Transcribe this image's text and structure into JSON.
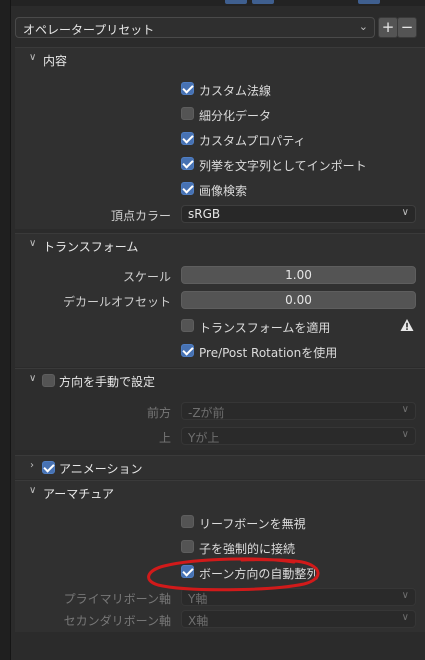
{
  "preset": {
    "label": "オペレータープリセット",
    "add": "+",
    "remove": "−"
  },
  "content": {
    "title": "内容",
    "items": [
      {
        "label": "カスタム法線",
        "checked": true
      },
      {
        "label": "細分化データ",
        "checked": false
      },
      {
        "label": "カスタムプロパティ",
        "checked": true
      },
      {
        "label": "列挙を文字列としてインポート",
        "checked": true
      },
      {
        "label": "画像検索",
        "checked": true
      }
    ],
    "vertex_color": {
      "label": "頂点カラー",
      "value": "sRGB"
    }
  },
  "transform": {
    "title": "トランスフォーム",
    "scale": {
      "label": "スケール",
      "value": "1.00"
    },
    "decal_offset": {
      "label": "デカールオフセット",
      "value": "0.00"
    },
    "apply_transform": {
      "label": "トランスフォームを適用",
      "checked": false
    },
    "pre_post_rotation": {
      "label": "Pre/Post Rotationを使用",
      "checked": true
    }
  },
  "manual_orientation": {
    "title": "方向を手動で設定",
    "checked": false,
    "forward": {
      "label": "前方",
      "value": "-Zが前"
    },
    "up": {
      "label": "上",
      "value": "Yが上"
    }
  },
  "animation": {
    "title": "アニメーション",
    "checked": true
  },
  "armature": {
    "title": "アーマチュア",
    "ignore_leaf_bones": {
      "label": "リーフボーンを無視",
      "checked": false
    },
    "force_connect": {
      "label": "子を強制的に接続",
      "checked": false
    },
    "auto_bone_orientation": {
      "label": "ボーン方向の自動整列",
      "checked": true
    },
    "primary_axis": {
      "label": "プライマリボーン軸",
      "value": "Y軸"
    },
    "secondary_axis": {
      "label": "セカンダリボーン軸",
      "value": "X軸"
    }
  },
  "colors": {
    "accent": "#4772b3",
    "annotation": "#d11a1a"
  }
}
